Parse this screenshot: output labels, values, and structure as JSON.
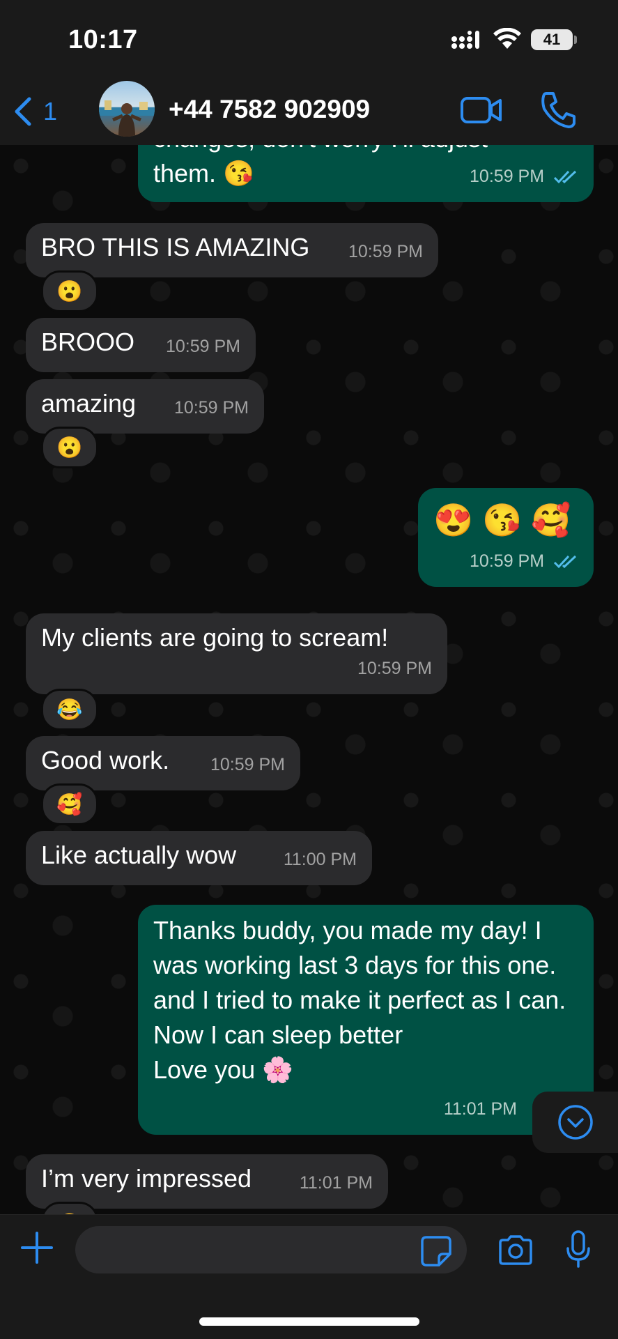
{
  "status": {
    "time": "10:17",
    "battery": "41"
  },
  "header": {
    "back_count": "1",
    "contact": "+44 7582 902909"
  },
  "messages": [
    {
      "partial_text": "changes, don't worry I'll adjust",
      "text": "them. 😘",
      "time": "10:59 PM"
    },
    {
      "text": "BRO THIS IS AMAZING",
      "time": "10:59 PM",
      "reaction": "😮"
    },
    {
      "text": "BROOO",
      "time": "10:59 PM"
    },
    {
      "text": "amazing",
      "time": "10:59 PM",
      "reaction": "😮"
    },
    {
      "text": "😍 😘 🥰",
      "time": "10:59 PM"
    },
    {
      "text": "My clients are going to scream!",
      "time": "10:59 PM",
      "reaction": "😂"
    },
    {
      "text": "Good work.",
      "time": "10:59 PM",
      "reaction": "🥰"
    },
    {
      "text": "Like actually wow",
      "time": "11:00 PM"
    },
    {
      "text": "Thanks buddy, you made my day! I was working last 3 days for this one.\nand I tried to make it perfect as I can. Now I can sleep better\nLove you 🌸",
      "time": "11:01 PM"
    },
    {
      "text": "I’m very impressed",
      "time": "11:01 PM"
    }
  ],
  "composer": {
    "placeholder": ""
  },
  "colors": {
    "accent": "#2d8cf0",
    "incoming": "#2b2b2d",
    "outgoing": "#005144"
  }
}
